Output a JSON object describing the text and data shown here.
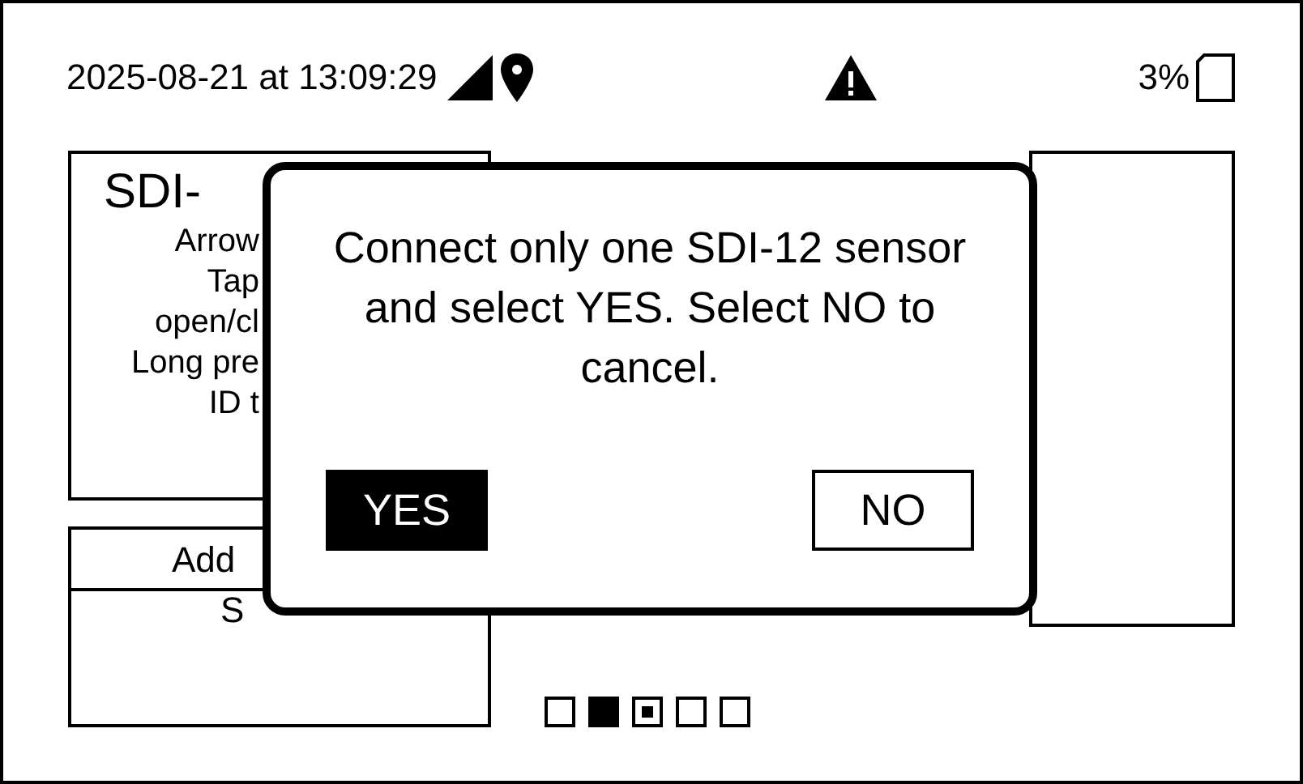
{
  "status_bar": {
    "datetime": "2025-08-21 at 13:09:29",
    "battery": "3%"
  },
  "left_panel": {
    "title": "SDI-",
    "lines": [
      "Arrow",
      "Tap",
      "open/cl",
      "Long pre",
      "ID t"
    ]
  },
  "action_button": {
    "label": "Add"
  },
  "list_items": [
    "S"
  ],
  "pager": [
    {
      "kind": "empty"
    },
    {
      "kind": "filled"
    },
    {
      "kind": "current"
    },
    {
      "kind": "empty"
    },
    {
      "kind": "empty"
    }
  ],
  "dialog": {
    "message": "Connect only one SDI-12 sensor and select YES. Select NO to cancel.",
    "buttons": [
      {
        "label": "YES",
        "selected": true
      },
      {
        "label": "NO",
        "selected": false
      }
    ]
  }
}
